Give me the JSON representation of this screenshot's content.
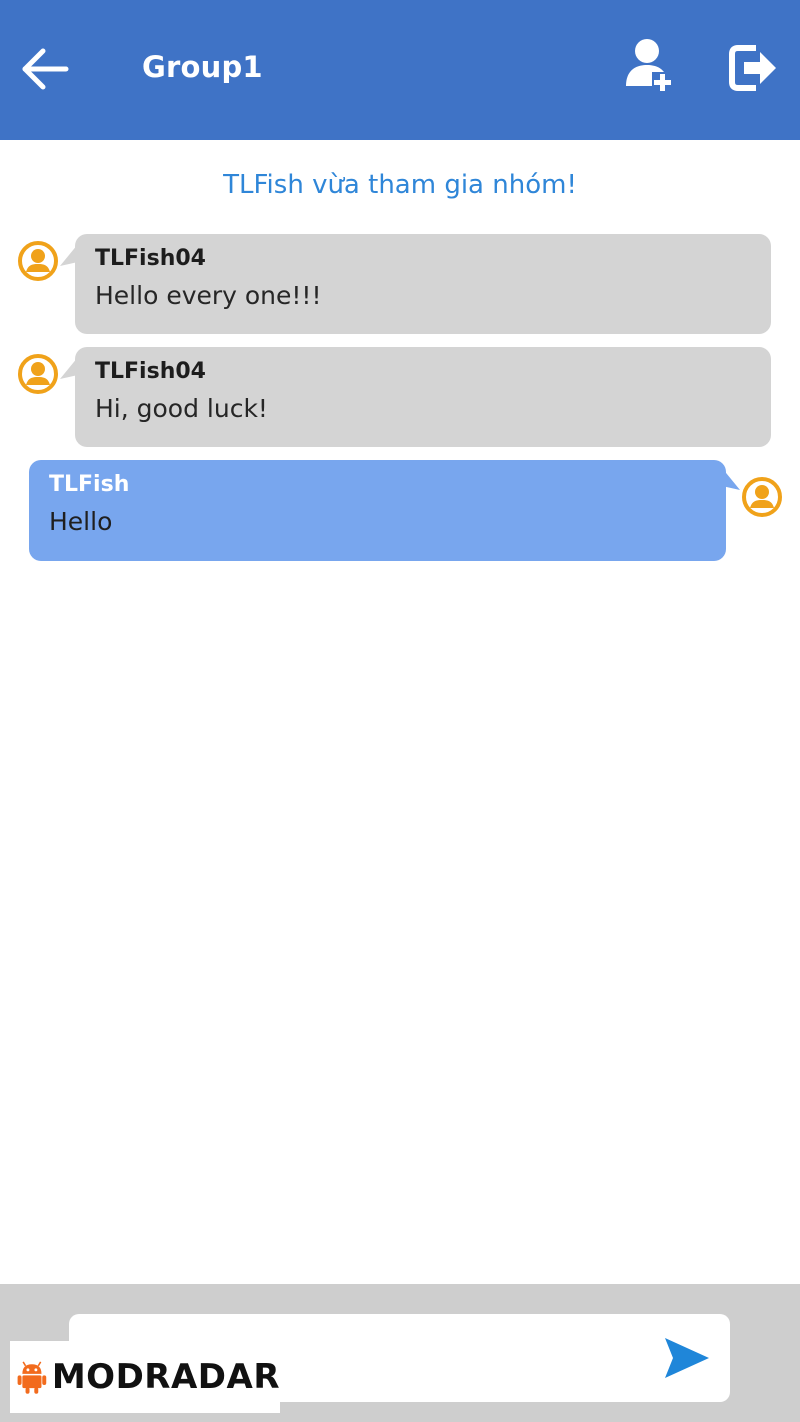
{
  "header": {
    "title": "Group1",
    "back_icon": "arrow-left-icon",
    "add_member_icon": "user-plus-icon",
    "leave_icon": "sign-out-icon",
    "background_color": "#3f73c6"
  },
  "system_notice": "TLFish vừa tham gia nhóm!",
  "messages": [
    {
      "sender": "TLFish04",
      "text": "Hello every one!!!",
      "direction": "incoming"
    },
    {
      "sender": "TLFish04",
      "text": "Hi, good luck!",
      "direction": "incoming"
    },
    {
      "sender": "TLFish",
      "text": "Hello",
      "direction": "outgoing"
    }
  ],
  "composer": {
    "placeholder": "",
    "send_icon": "send-icon"
  },
  "watermark": {
    "text": "MODRADAR",
    "icon": "android-icon"
  },
  "colors": {
    "incoming_bubble": "#d4d4d4",
    "outgoing_bubble": "#78a6ee",
    "avatar": "#f0a21a",
    "notice_text": "#2f86d8"
  }
}
